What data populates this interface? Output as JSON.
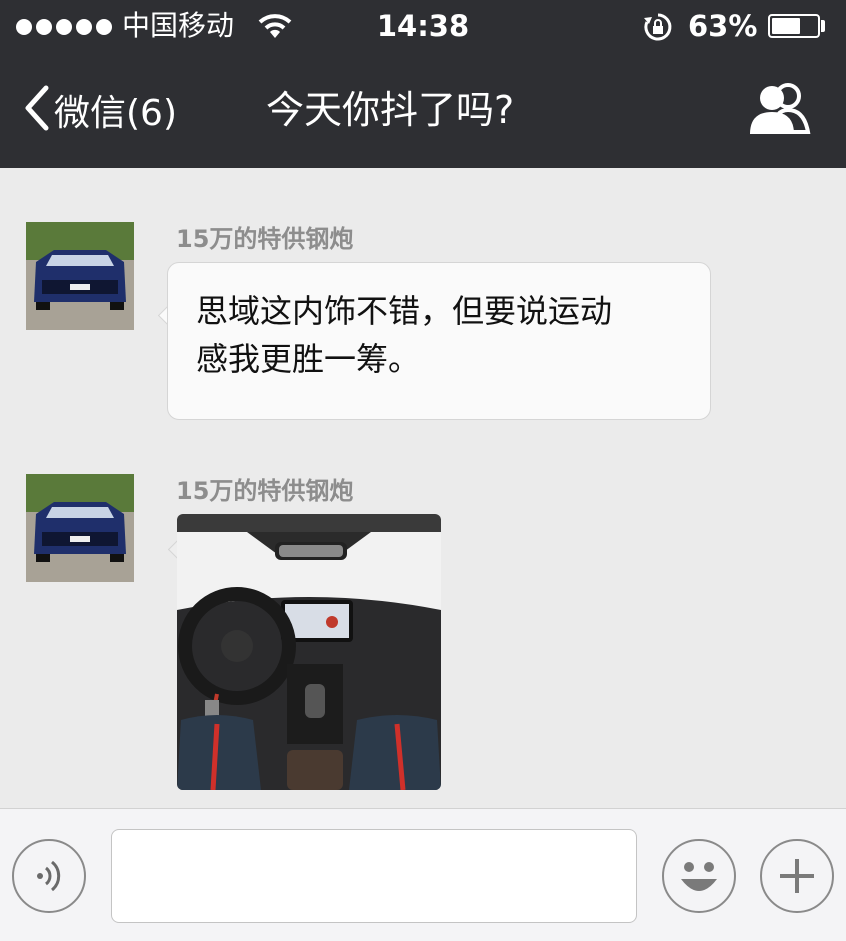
{
  "status_bar": {
    "carrier": "中国移动",
    "time": "14:38",
    "battery_percent": "63%",
    "battery_level": 0.63,
    "signal_dots": 5
  },
  "nav": {
    "back_label": "微信(6)",
    "title": "今天你抖了吗?"
  },
  "messages": [
    {
      "sender": "15万的特供钢炮",
      "type": "text",
      "text_line1": "思域这内饰不错，但要说运动",
      "text_line2": "感我更胜一筹。"
    },
    {
      "sender": "15万的特供钢炮",
      "type": "image",
      "image_desc": "car-interior-photo"
    }
  ],
  "input_bar": {
    "value": "",
    "voice_icon": "voice-icon",
    "emoji_icon": "emoji-icon",
    "plus_icon": "plus-icon"
  },
  "colors": {
    "nav_background": "#2e2f33",
    "chat_background": "#ebebeb",
    "bubble_background": "#fafafa",
    "sender_name": "#8d8d8d"
  }
}
